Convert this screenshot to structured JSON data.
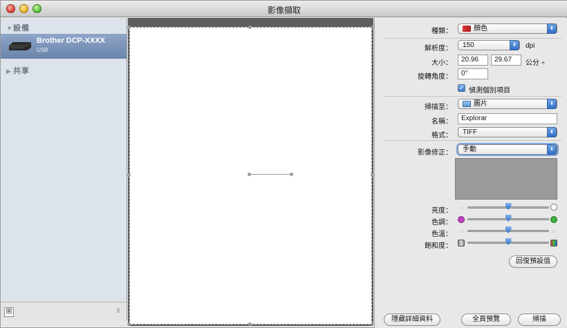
{
  "window": {
    "title": "影像擷取"
  },
  "sidebar": {
    "devices_header": "設備",
    "shared_header": "共享",
    "device": {
      "name": "Brother DCP-XXXX",
      "connection": "USB"
    }
  },
  "settings": {
    "kind": {
      "label": "種類：",
      "value": "顏色"
    },
    "resolution": {
      "label": "解析度：",
      "value": "150",
      "unit": "dpi"
    },
    "size": {
      "label": "大小：",
      "width": "20.96",
      "height": "29.67",
      "unit": "公分 ÷"
    },
    "rotation": {
      "label": "旋轉角度：",
      "value": "0°"
    },
    "detect_separate": {
      "label": "偵測個別項目",
      "checked": true
    },
    "scan_to": {
      "label": "掃描至：",
      "value": "圖片"
    },
    "name": {
      "label": "名稱：",
      "value": "Explorar"
    },
    "format": {
      "label": "格式：",
      "value": "TIFF"
    },
    "image_correction": {
      "label": "影像修正：",
      "value": "手動"
    },
    "brightness": {
      "label": "亮度：",
      "level": 0.5
    },
    "tint": {
      "label": "色調：",
      "level": 0.5
    },
    "temperature": {
      "label": "色溫：",
      "level": 0.5
    },
    "saturation": {
      "label": "飽和度：",
      "level": 0.5
    },
    "restore_defaults": "回復預設值"
  },
  "footer": {
    "hide_details": "隱藏詳細資料",
    "overview": "全頁預覽",
    "scan": "掃描"
  },
  "colors": {
    "selection": "#6b84ab",
    "accent": "#2f6fc8",
    "preview_bg": "#5e5e5e",
    "swatch": "#9a9a9a"
  }
}
